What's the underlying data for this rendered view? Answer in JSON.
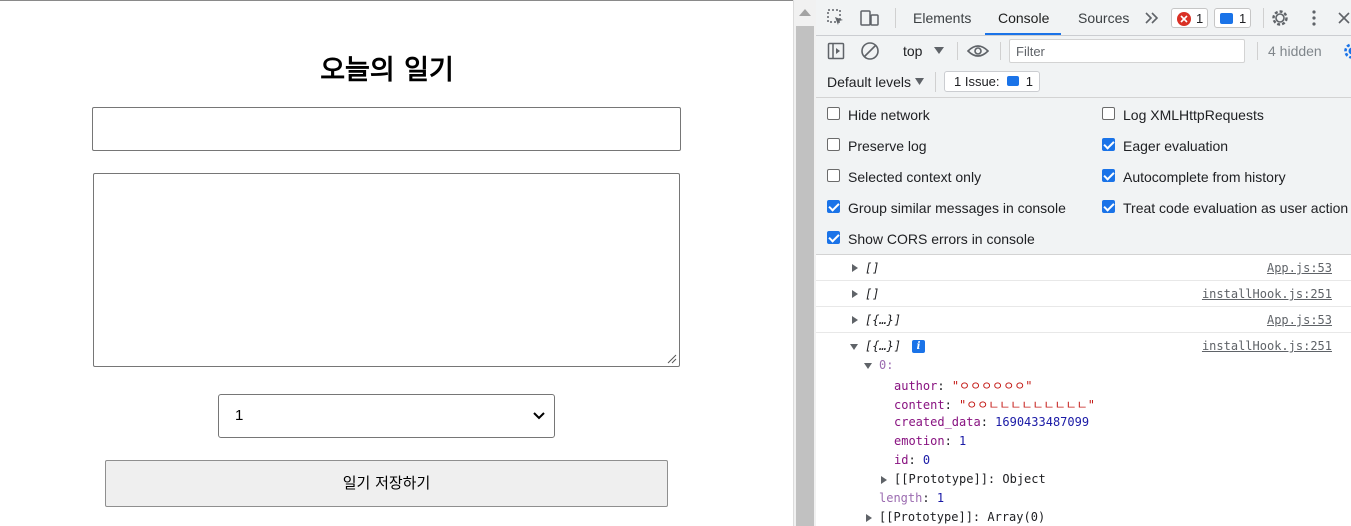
{
  "app": {
    "title": "오늘의 일기",
    "author_value": "",
    "content_value": "",
    "emotion_selected": "1",
    "save_label": "일기 저장하기"
  },
  "devtools": {
    "tabs": [
      "Elements",
      "Console",
      "Sources"
    ],
    "active_tab": "Console",
    "error_count": "1",
    "message_count": "1",
    "context": "top",
    "filter_placeholder": "Filter",
    "hidden_label": "4 hidden",
    "levels_label": "Default levels",
    "issue_label": "1 Issue:",
    "issue_count": "1",
    "settings": {
      "hide_network": "Hide network",
      "preserve_log": "Preserve log",
      "selected_context": "Selected context only",
      "group_similar": "Group similar messages in console",
      "show_cors": "Show CORS errors in console",
      "log_xhr": "Log XMLHttpRequests",
      "eager_eval": "Eager evaluation",
      "autocomplete": "Autocomplete from history",
      "treat_user": "Treat code evaluation as user action"
    },
    "console": {
      "rows": [
        {
          "message": "[]",
          "source": "App.js:53"
        },
        {
          "message": "[]",
          "source": "installHook.js:251"
        },
        {
          "message": "[{…}]",
          "source": "App.js:53"
        },
        {
          "message": "[{…}]",
          "source": "installHook.js:251"
        }
      ],
      "tree": {
        "index": "0:",
        "author_key": "author",
        "author_val": "\"ㅇㅇㅇㅇㅇㅇ\"",
        "content_key": "content",
        "content_val": "\"ㅇㅇㄴㄴㄴㄴㄴㄴㄴㄴㄴ\"",
        "created_key": "created_data",
        "created_val": "1690433487099",
        "emotion_key": "emotion",
        "emotion_val": "1",
        "id_key": "id",
        "id_val": "0",
        "proto_key": "[[Prototype]]",
        "proto_val": "Object",
        "length_key": "length",
        "length_val": "1",
        "proto2_key": "[[Prototype]]",
        "proto2_val": "Array(0)"
      }
    }
  }
}
